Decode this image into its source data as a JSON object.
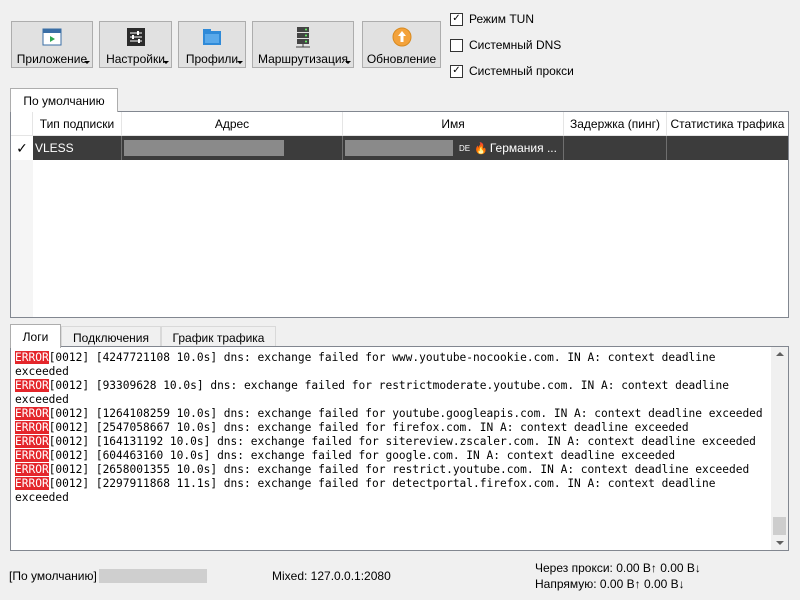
{
  "toolbar": {
    "buttons": [
      {
        "label": "Приложение",
        "icon": "play-window-icon"
      },
      {
        "label": "Настройки",
        "icon": "sliders-icon"
      },
      {
        "label": "Профили",
        "icon": "folder-icon"
      },
      {
        "label": "Маршрутизация",
        "icon": "server-icon"
      },
      {
        "label": "Обновление",
        "icon": "update-icon"
      }
    ],
    "checks": [
      {
        "label": "Режим TUN",
        "checked": true
      },
      {
        "label": "Системный DNS",
        "checked": false
      },
      {
        "label": "Системный прокси",
        "checked": true
      }
    ]
  },
  "profile_tab": "По умолчанию",
  "table": {
    "headers": [
      "Тип подписки",
      "Адрес",
      "Имя",
      "Задержка (пинг)",
      "Статистика трафика"
    ],
    "row": {
      "check": "✓",
      "type": "VLESS",
      "name_flag": "DE",
      "name_fire": "🔥",
      "name": "Германия ..."
    }
  },
  "bottom_tabs": [
    "Логи",
    "Подключения",
    "График трафика"
  ],
  "logs": [
    {
      "tag": "ERROR",
      "text": "[0012] [4247721108 10.0s] dns: exchange failed for www.youtube-nocookie.com. IN A: context deadline exceeded"
    },
    {
      "tag": "ERROR",
      "text": "[0012] [93309628 10.0s] dns: exchange failed for restrictmoderate.youtube.com. IN A: context deadline exceeded"
    },
    {
      "tag": "ERROR",
      "text": "[0012] [1264108259 10.0s] dns: exchange failed for youtube.googleapis.com. IN A: context deadline exceeded"
    },
    {
      "tag": "ERROR",
      "text": "[0012] [2547058667 10.0s] dns: exchange failed for firefox.com. IN A: context deadline exceeded"
    },
    {
      "tag": "ERROR",
      "text": "[0012] [164131192 10.0s] dns: exchange failed for sitereview.zscaler.com. IN A: context deadline exceeded"
    },
    {
      "tag": "ERROR",
      "text": "[0012] [604463160 10.0s] dns: exchange failed for google.com. IN A: context deadline exceeded"
    },
    {
      "tag": "ERROR",
      "text": "[0012] [2658001355 10.0s] dns: exchange failed for restrict.youtube.com. IN A: context deadline exceeded"
    },
    {
      "tag": "ERROR",
      "text": "[0012] [2297911868 11.1s] dns: exchange failed for detectportal.firefox.com. IN A: context deadline exceeded"
    }
  ],
  "status": {
    "profile": "[По умолчанию]",
    "mixed": "Mixed: 127.0.0.1:2080",
    "proxy": "Через прокси: 0.00 B↑ 0.00 B↓",
    "direct": "Напрямую: 0.00 B↑ 0.00 B↓"
  }
}
